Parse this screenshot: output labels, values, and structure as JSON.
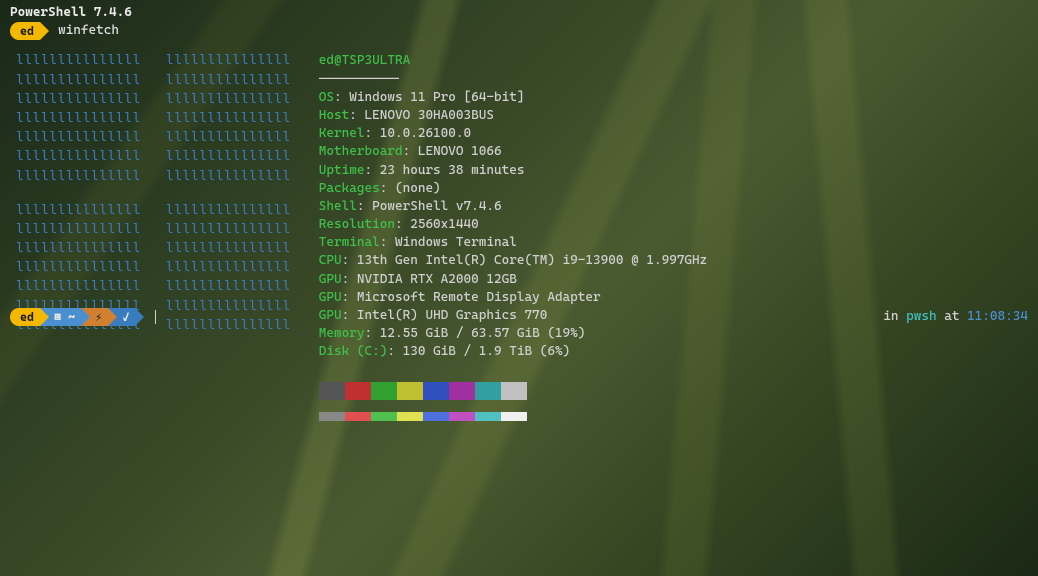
{
  "title": "PowerShell 7.4.6",
  "prompt1": {
    "user": "ed",
    "command": "winfetch"
  },
  "logo": {
    "glyph1": "lllllllllllllll",
    "glyph2": "lllllllllllllll"
  },
  "winfetch": {
    "header": "ed@TSP3ULTRA",
    "separator": "————————————",
    "rows": [
      {
        "label": "OS",
        "value": "Windows 11 Pro [64-bit]"
      },
      {
        "label": "Host",
        "value": "LENOVO 30HA003BUS"
      },
      {
        "label": "Kernel",
        "value": "10.0.26100.0"
      },
      {
        "label": "Motherboard",
        "value": "LENOVO 1066"
      },
      {
        "label": "Uptime",
        "value": "23 hours 38 minutes"
      },
      {
        "label": "Packages",
        "value": "(none)"
      },
      {
        "label": "Shell",
        "value": "PowerShell v7.4.6"
      },
      {
        "label": "Resolution",
        "value": "2560x1440"
      },
      {
        "label": "Terminal",
        "value": "Windows Terminal"
      },
      {
        "label": "CPU",
        "value": "13th Gen Intel(R) Core(TM) i9-13900 @ 1.997GHz"
      },
      {
        "label": "GPU",
        "value": "NVIDIA RTX A2000 12GB"
      },
      {
        "label": "GPU",
        "value": "Microsoft Remote Display Adapter"
      },
      {
        "label": "GPU",
        "value": "Intel(R) UHD Graphics 770"
      },
      {
        "label": "Memory",
        "value": "12.55 GiB / 63.57 GiB (19%)"
      },
      {
        "label": "Disk (C:)",
        "value": "130 GiB / 1.9 TiB (6%)"
      }
    ]
  },
  "swatches_top": [
    "#555555",
    "#c03030",
    "#30a030",
    "#c0c030",
    "#3050c0",
    "#a030a0",
    "#30a0a0",
    "#c0c0c0"
  ],
  "swatches_bottom": [
    "#888888",
    "#e05050",
    "#50c050",
    "#e0e050",
    "#5070e0",
    "#c050c0",
    "#50c0c0",
    "#f0f0f0"
  ],
  "prompt2": {
    "user": "ed",
    "folder": "▣ ~",
    "bolt": "⚡",
    "check": "✓"
  },
  "right": {
    "in": "in ",
    "shell": "pwsh",
    "at": " at ",
    "time": "11:08:34"
  }
}
